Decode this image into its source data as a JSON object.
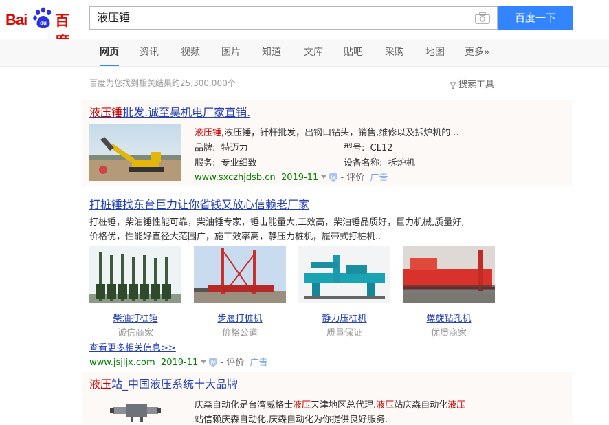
{
  "logo": {
    "left": "Bai",
    "right": "百度",
    "paw_text": "du"
  },
  "search": {
    "query": "液压锤",
    "button": "百度一下"
  },
  "nav": [
    "网页",
    "资讯",
    "视频",
    "图片",
    "知道",
    "文库",
    "贴吧",
    "采购",
    "地图",
    "更多»"
  ],
  "stats": "百度为您找到相关结果约25,300,000个",
  "tools": "搜索工具",
  "result1": {
    "title_em": "液压锤",
    "title_rest": "批发.诚至昊机电厂家直销.",
    "desc_em": "液压锤",
    "desc_rest": ",液压锤，钎杆批发，出钢口钻头，销售,维修以及拆炉机的...",
    "fields": [
      {
        "label": "品牌:",
        "value": "特迈力"
      },
      {
        "label": "型号:",
        "value": "CL12"
      },
      {
        "label": "服务:",
        "value": "专业细致"
      },
      {
        "label": "设备名称:",
        "value": "拆炉机"
      }
    ],
    "url": "www.sxczhjdsb.cn",
    "date": "2019-11",
    "rate": "- 评价",
    "ad": "广告"
  },
  "result2": {
    "title": "打桩锤找东台巨力让你省钱又放心信赖老厂家",
    "desc1": "打桩锤，柴油锤性能可靠，柴油锤专家，锤击能量大,工效高，柴油锤品质好，巨力机械,质量好,",
    "desc2": "价格优，性能好直径大范围广，施工效率高，静压力桩机，履带式打桩机..",
    "images": [
      {
        "caption": "柴油打桩锤",
        "sub": "诚信商家"
      },
      {
        "caption": "步履打桩机",
        "sub": "价格公道"
      },
      {
        "caption": "静力压桩机",
        "sub": "质量保证"
      },
      {
        "caption": "螺旋钻孔机",
        "sub": "优质商家"
      }
    ],
    "more": "查看更多相关信息>>",
    "url": "www.jsjljx.com",
    "date": "2019-11",
    "rate": "- 评价",
    "ad": "广告"
  },
  "result3": {
    "title_em": "液压",
    "title_rest": "站_中国液压系统十大品牌",
    "desc1_a": "庆森自动化是台湾威格士",
    "desc1_em1": "液压",
    "desc1_b": "天津地区总代理.",
    "desc1_em2": "液压",
    "desc1_c": "站庆森自动化",
    "desc1_em3": "液压",
    "desc2": "站信赖庆森自动化,庆森自动化为你提供良好服务."
  }
}
